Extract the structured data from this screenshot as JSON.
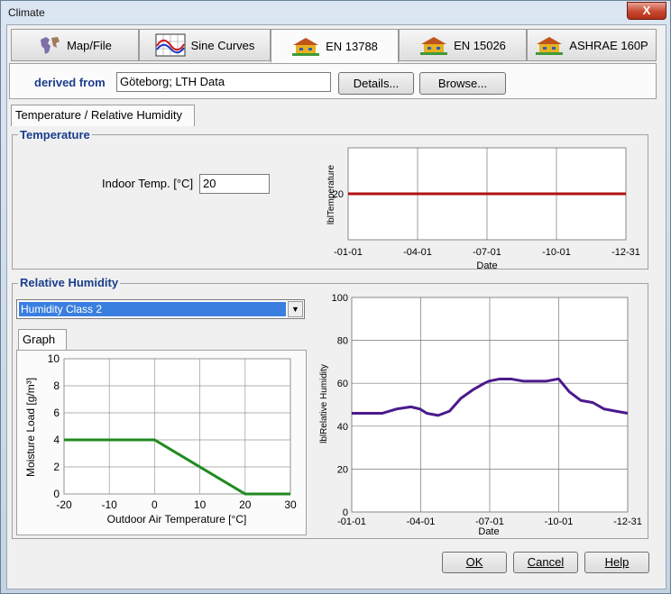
{
  "window": {
    "title": "Climate",
    "close_label": "X"
  },
  "tabs": [
    {
      "label": "Map/File",
      "icon": "world-map-icon"
    },
    {
      "label": "Sine Curves",
      "icon": "sine-curves-icon"
    },
    {
      "label": "EN 13788",
      "icon": "house-icon"
    },
    {
      "label": "EN 15026",
      "icon": "house-icon"
    },
    {
      "label": "ASHRAE 160P",
      "icon": "house-icon"
    }
  ],
  "active_tab": "EN 13788",
  "source": {
    "label": "derived from",
    "value": "Göteborg; LTH Data",
    "details_label": "Details...",
    "browse_label": "Browse..."
  },
  "subtab": {
    "label": "Temperature / Relative Humidity"
  },
  "temperature": {
    "group_title": "Temperature",
    "indoor_label": "Indoor Temp. [°C]",
    "indoor_value": "20",
    "chart": {
      "ylabel": "lblTemperature",
      "xlabel": "Date",
      "x_ticks": [
        "-01-01",
        "-04-01",
        "-07-01",
        "-10-01",
        "-12-31"
      ],
      "y_ticks": [
        "20"
      ],
      "line_color": "#b01010"
    }
  },
  "humidity": {
    "group_title": "Relative Humidity",
    "class_value": "Humidity Class 2",
    "graph_tab_label": "Graph",
    "load_chart": {
      "xlabel": "Outdoor Air Temperature [°C]",
      "ylabel": "Moisture Load [g/m³]",
      "x_ticks": [
        "-20",
        "-10",
        "0",
        "10",
        "20",
        "30"
      ],
      "y_ticks": [
        "0",
        "2",
        "4",
        "6",
        "8",
        "10"
      ],
      "line_color": "#1f8a1f"
    },
    "rh_chart": {
      "ylabel": "lblRelative Humidity",
      "xlabel": "Date",
      "x_ticks": [
        "-01-01",
        "-04-01",
        "-07-01",
        "-10-01",
        "-12-31"
      ],
      "y_ticks": [
        "0",
        "20",
        "40",
        "60",
        "80",
        "100"
      ],
      "line_color": "#4b1a8c"
    }
  },
  "buttons": {
    "ok": "OK",
    "cancel": "Cancel",
    "help": "Help"
  },
  "chart_data": [
    {
      "type": "line",
      "ylabel": "lblTemperature",
      "xlabel": "Date",
      "x_range": [
        "01-01",
        "12-31"
      ],
      "x": [
        "01-01",
        "12-31"
      ],
      "values": [
        20,
        20
      ],
      "ylim": [
        15,
        25
      ],
      "grid": true
    },
    {
      "type": "line",
      "xlabel": "Outdoor Air Temperature [°C]",
      "ylabel": "Moisture Load [g/m³]",
      "x": [
        -20,
        0,
        20,
        30
      ],
      "values": [
        4,
        4,
        0,
        0
      ],
      "xlim": [
        -20,
        30
      ],
      "ylim": [
        0,
        10
      ],
      "grid": true
    },
    {
      "type": "line",
      "ylabel": "lblRelative Humidity",
      "xlabel": "Date",
      "x": [
        "01-01",
        "01-21",
        "02-10",
        "03-01",
        "03-20",
        "04-01",
        "04-10",
        "04-25",
        "05-10",
        "05-25",
        "06-10",
        "06-25",
        "07-01",
        "07-15",
        "07-30",
        "08-15",
        "08-30",
        "09-15",
        "09-30",
        "10-01",
        "10-15",
        "10-30",
        "11-15",
        "11-30",
        "12-15",
        "12-31"
      ],
      "values": [
        46,
        46,
        46,
        48,
        49,
        48,
        46,
        45,
        47,
        53,
        57,
        60,
        61,
        62,
        62,
        61,
        61,
        61,
        62,
        62,
        56,
        52,
        51,
        48,
        47,
        46
      ],
      "ylim": [
        0,
        100
      ],
      "grid": true
    }
  ]
}
